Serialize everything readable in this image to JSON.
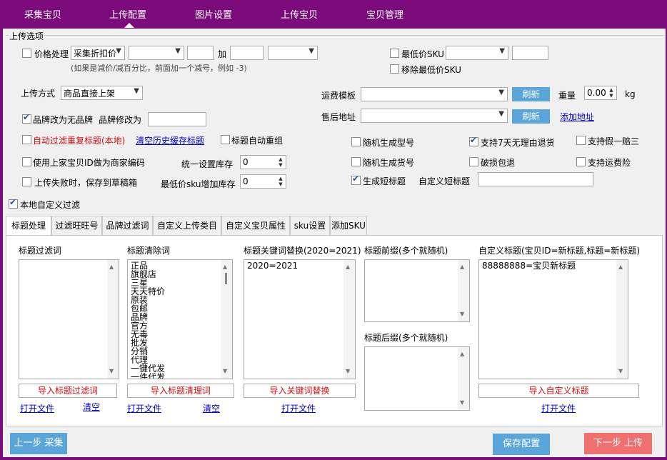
{
  "nav": {
    "tabs": [
      {
        "label": "采集宝贝"
      },
      {
        "label": "上传配置"
      },
      {
        "label": "图片设置"
      },
      {
        "label": "上传宝贝"
      },
      {
        "label": "宝贝管理"
      }
    ],
    "active_index": 1
  },
  "upload_options": {
    "group_title": "上传选项",
    "price": {
      "label": "价格处理",
      "checked": false,
      "mode_select": "采集折扣价",
      "select2": "",
      "input1": "",
      "plus_label": "加",
      "input2": "",
      "select3": "",
      "hint": "(如果是减价/减百分比，前面加一个减号，例如 -3)"
    },
    "lowest_sku": {
      "label": "最低价SKU",
      "checked": false,
      "select": "",
      "input": ""
    },
    "remove_lowest_sku": {
      "label": "移除最低价SKU",
      "checked": false
    },
    "upload_mode": {
      "label": "上传方式",
      "value": "商品直接上架"
    },
    "shipping": {
      "label": "运费模板",
      "value": "",
      "refresh": "刷新"
    },
    "weight": {
      "label": "重量",
      "value": "0.00",
      "unit": "kg"
    },
    "brand": {
      "label": "品牌改为无品牌",
      "checked": true,
      "modify_label": "品牌修改为",
      "modify_value": ""
    },
    "after_sale": {
      "label": "售后地址",
      "value": "",
      "refresh": "刷新",
      "add_link": "添加地址"
    },
    "auto_filter": {
      "label": "自动过滤重复标题(本地)",
      "checked": false,
      "clear_link": "清空历史缓存标题"
    },
    "title_regroup": {
      "label": "标题自动重组",
      "checked": false
    },
    "random_model": {
      "label": "随机生成型号",
      "checked": false
    },
    "seven_day": {
      "label": "支持7天无理由退货",
      "checked": true
    },
    "fake_refund": {
      "label": "支持假一赔三",
      "checked": false
    },
    "use_code": {
      "label": "使用上家宝贝ID做为商家编码",
      "checked": false
    },
    "unified_stock": {
      "label": "统一设置库存",
      "value": "0"
    },
    "random_item_no": {
      "label": "随机生成货号",
      "checked": false
    },
    "damage_cover": {
      "label": "破损包退",
      "checked": false
    },
    "freight_insurance": {
      "label": "支持运费险",
      "checked": false
    },
    "save_draft": {
      "label": "上传失败时，保存到草稿箱",
      "checked": false
    },
    "lowest_sku_stock": {
      "label": "最低价sku增加库存",
      "value": "0"
    },
    "short_title": {
      "label": "生成短标题",
      "checked": true,
      "custom_label": "自定义短标题",
      "custom_value": ""
    },
    "local_filter": {
      "label": "本地自定义过滤",
      "checked": true
    }
  },
  "sub_tabs": [
    {
      "label": "标题处理"
    },
    {
      "label": "过滤旺旺号"
    },
    {
      "label": "品牌过滤词"
    },
    {
      "label": "自定义上传类目"
    },
    {
      "label": "自定义宝贝属性"
    },
    {
      "label": "sku设置"
    },
    {
      "label": "添加SKU"
    }
  ],
  "title_panel": {
    "filter_words": {
      "label": "标题过滤词",
      "content": "",
      "import_btn": "导入标题过滤词",
      "open": "打开文件",
      "clear": "清空"
    },
    "remove_words": {
      "label": "标题清除词",
      "lines": [
        "正品",
        "旗舰店",
        "三星",
        "天天特价",
        "原装",
        "包邮",
        "品牌",
        "官方",
        "无毒",
        "批发",
        "分销",
        "代理",
        "一键代发",
        "一件代发"
      ],
      "import_btn": "导入标题清理词",
      "open": "打开文件",
      "clear": "清空"
    },
    "replace_words": {
      "label": "标题关键词替换(2020=2021)",
      "content": "2020=2021",
      "import_btn": "导入关键词替换",
      "open": "打开文件"
    },
    "prefix": {
      "label": "标题前缀(多个就随机)",
      "content": ""
    },
    "suffix": {
      "label": "标题后缀(多个就随机)",
      "content": ""
    },
    "custom_title": {
      "label": "自定义标题(宝贝ID=新标题,标题=新标题)",
      "content": "88888888=宝贝新标题",
      "import_btn": "导入自定义标题",
      "open": "打开文件"
    }
  },
  "footer": {
    "prev": "上一步 采集",
    "save": "保存配置",
    "next": "下一步 上传"
  },
  "colors": {
    "nav_bg": "#7b0a7b",
    "panel_bg": "#f0f0f0",
    "btn_blue": "#5aa6db",
    "btn_red": "#f07070",
    "red_text": "#cc1010",
    "link": "#0000cc"
  }
}
